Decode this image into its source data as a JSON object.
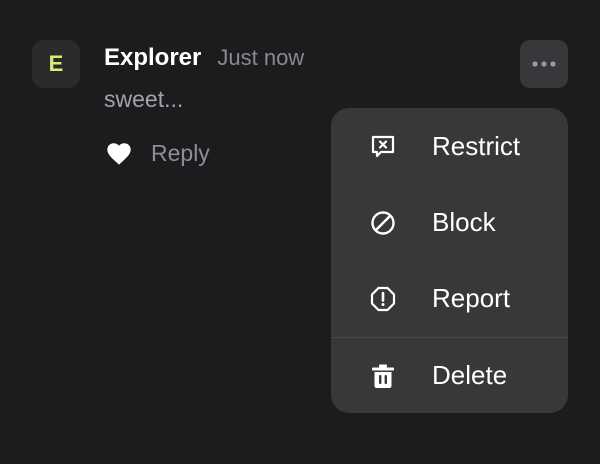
{
  "comment": {
    "avatar_letter": "E",
    "author": "Explorer",
    "time": "Just now",
    "text": "sweet...",
    "reply_label": "Reply"
  },
  "menu": {
    "items": [
      {
        "label": "Restrict",
        "icon": "restrict-icon"
      },
      {
        "label": "Block",
        "icon": "block-icon"
      },
      {
        "label": "Report",
        "icon": "report-icon"
      },
      {
        "label": "Delete",
        "icon": "trash-icon"
      }
    ]
  },
  "colors": {
    "background": "#1c1c1e",
    "menu_background": "#38383b",
    "avatar_letter": "#d7ef6f",
    "secondary_text": "#8e8e93"
  }
}
